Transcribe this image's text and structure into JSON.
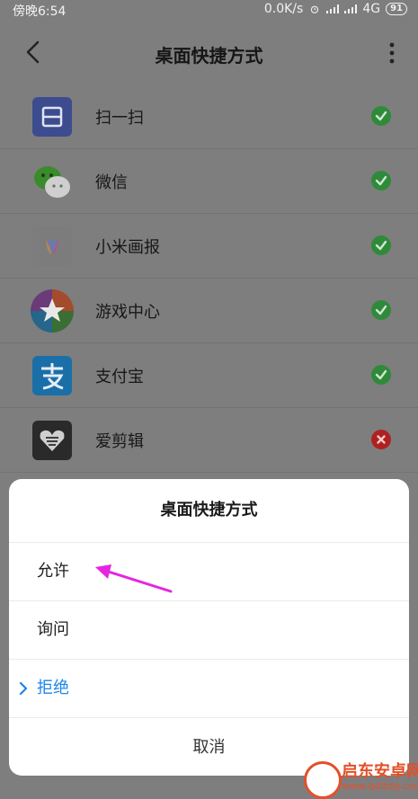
{
  "status_bar": {
    "time": "傍晚6:54",
    "speed": "0.0K/s",
    "network": "4G",
    "battery": "91"
  },
  "header": {
    "title": "桌面快捷方式"
  },
  "apps": [
    {
      "label": "扫一扫",
      "state": "allowed"
    },
    {
      "label": "微信",
      "state": "allowed"
    },
    {
      "label": "小米画报",
      "state": "allowed"
    },
    {
      "label": "游戏中心",
      "state": "allowed"
    },
    {
      "label": "支付宝",
      "state": "allowed"
    },
    {
      "label": "爱剪辑",
      "state": "denied"
    }
  ],
  "colors": {
    "allowed": "#2f8a3a",
    "denied": "#b02020",
    "selected": "#1b86ea",
    "arrow": "#e526e0"
  },
  "dialog": {
    "title": "桌面快捷方式",
    "options": [
      {
        "label": "允许",
        "selected": false
      },
      {
        "label": "询问",
        "selected": false
      },
      {
        "label": "拒绝",
        "selected": true
      }
    ],
    "cancel_label": "取消"
  },
  "watermark": {
    "name": "启东安卓网",
    "url": "www.qdltdq.com"
  }
}
